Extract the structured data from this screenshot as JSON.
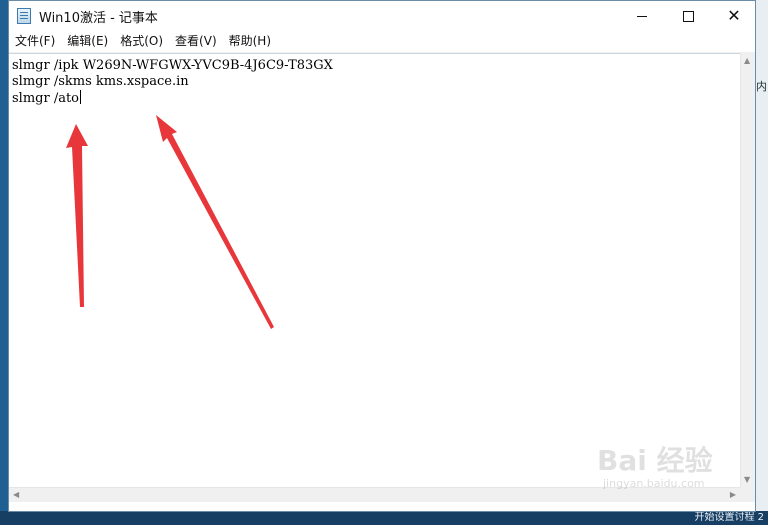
{
  "window": {
    "title": "Win10激活 - 记事本"
  },
  "menu": {
    "items": [
      "文件(F)",
      "编辑(E)",
      "格式(O)",
      "查看(V)",
      "帮助(H)"
    ]
  },
  "editor": {
    "lines": [
      "slmgr /ipk W269N-WFGWX-YVC9B-4J6C9-T83GX",
      "slmgr /skms kms.xspace.in",
      "slmgr /ato"
    ]
  },
  "annotations": {
    "arrow_color": "#e8373b"
  },
  "watermark": {
    "brand": "Bai 经验",
    "url": "jingyan.baidu.com"
  },
  "desktop": {
    "right_edge_chars": [
      "内"
    ],
    "bottom_text": "开始设置讨程 2"
  }
}
